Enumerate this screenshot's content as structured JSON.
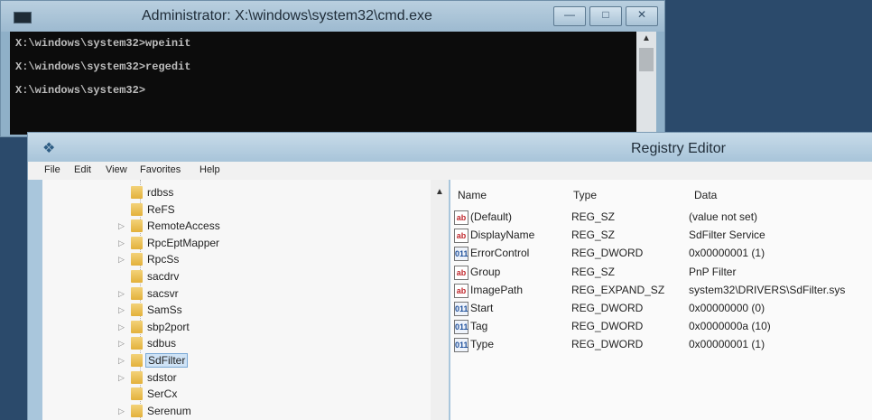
{
  "cmd": {
    "title": "Administrator: X:\\windows\\system32\\cmd.exe",
    "lines": [
      "X:\\windows\\system32>wpeinit",
      "X:\\windows\\system32>regedit",
      "X:\\windows\\system32>"
    ],
    "buttons": {
      "minimize": "—",
      "maximize": "□",
      "close": "✕"
    }
  },
  "regedit": {
    "title": "Registry Editor",
    "menu": [
      "File",
      "Edit",
      "View",
      "Favorites",
      "Help"
    ],
    "tree": [
      {
        "label": "rdbss",
        "expandable": false
      },
      {
        "label": "ReFS",
        "expandable": false
      },
      {
        "label": "RemoteAccess",
        "expandable": true
      },
      {
        "label": "RpcEptMapper",
        "expandable": true
      },
      {
        "label": "RpcSs",
        "expandable": true
      },
      {
        "label": "sacdrv",
        "expandable": false
      },
      {
        "label": "sacsvr",
        "expandable": true
      },
      {
        "label": "SamSs",
        "expandable": true
      },
      {
        "label": "sbp2port",
        "expandable": true
      },
      {
        "label": "sdbus",
        "expandable": true
      },
      {
        "label": "SdFilter",
        "expandable": true,
        "selected": true
      },
      {
        "label": "sdstor",
        "expandable": true
      },
      {
        "label": "SerCx",
        "expandable": false
      },
      {
        "label": "Serenum",
        "expandable": true
      }
    ],
    "columns": {
      "name": "Name",
      "type": "Type",
      "data": "Data"
    },
    "values": [
      {
        "icon": "ab",
        "name": "(Default)",
        "type": "REG_SZ",
        "data": "(value not set)"
      },
      {
        "icon": "ab",
        "name": "DisplayName",
        "type": "REG_SZ",
        "data": "SdFilter Service"
      },
      {
        "icon": "dw",
        "name": "ErrorControl",
        "type": "REG_DWORD",
        "data": "0x00000001 (1)"
      },
      {
        "icon": "ab",
        "name": "Group",
        "type": "REG_SZ",
        "data": "PnP Filter"
      },
      {
        "icon": "ab",
        "name": "ImagePath",
        "type": "REG_EXPAND_SZ",
        "data": "system32\\DRIVERS\\SdFilter.sys"
      },
      {
        "icon": "dw",
        "name": "Start",
        "type": "REG_DWORD",
        "data": "0x00000000 (0)"
      },
      {
        "icon": "dw",
        "name": "Tag",
        "type": "REG_DWORD",
        "data": "0x0000000a (10)"
      },
      {
        "icon": "dw",
        "name": "Type",
        "type": "REG_DWORD",
        "data": "0x00000001 (1)"
      }
    ],
    "icon_text": {
      "ab": "ab",
      "dw": "011"
    }
  }
}
